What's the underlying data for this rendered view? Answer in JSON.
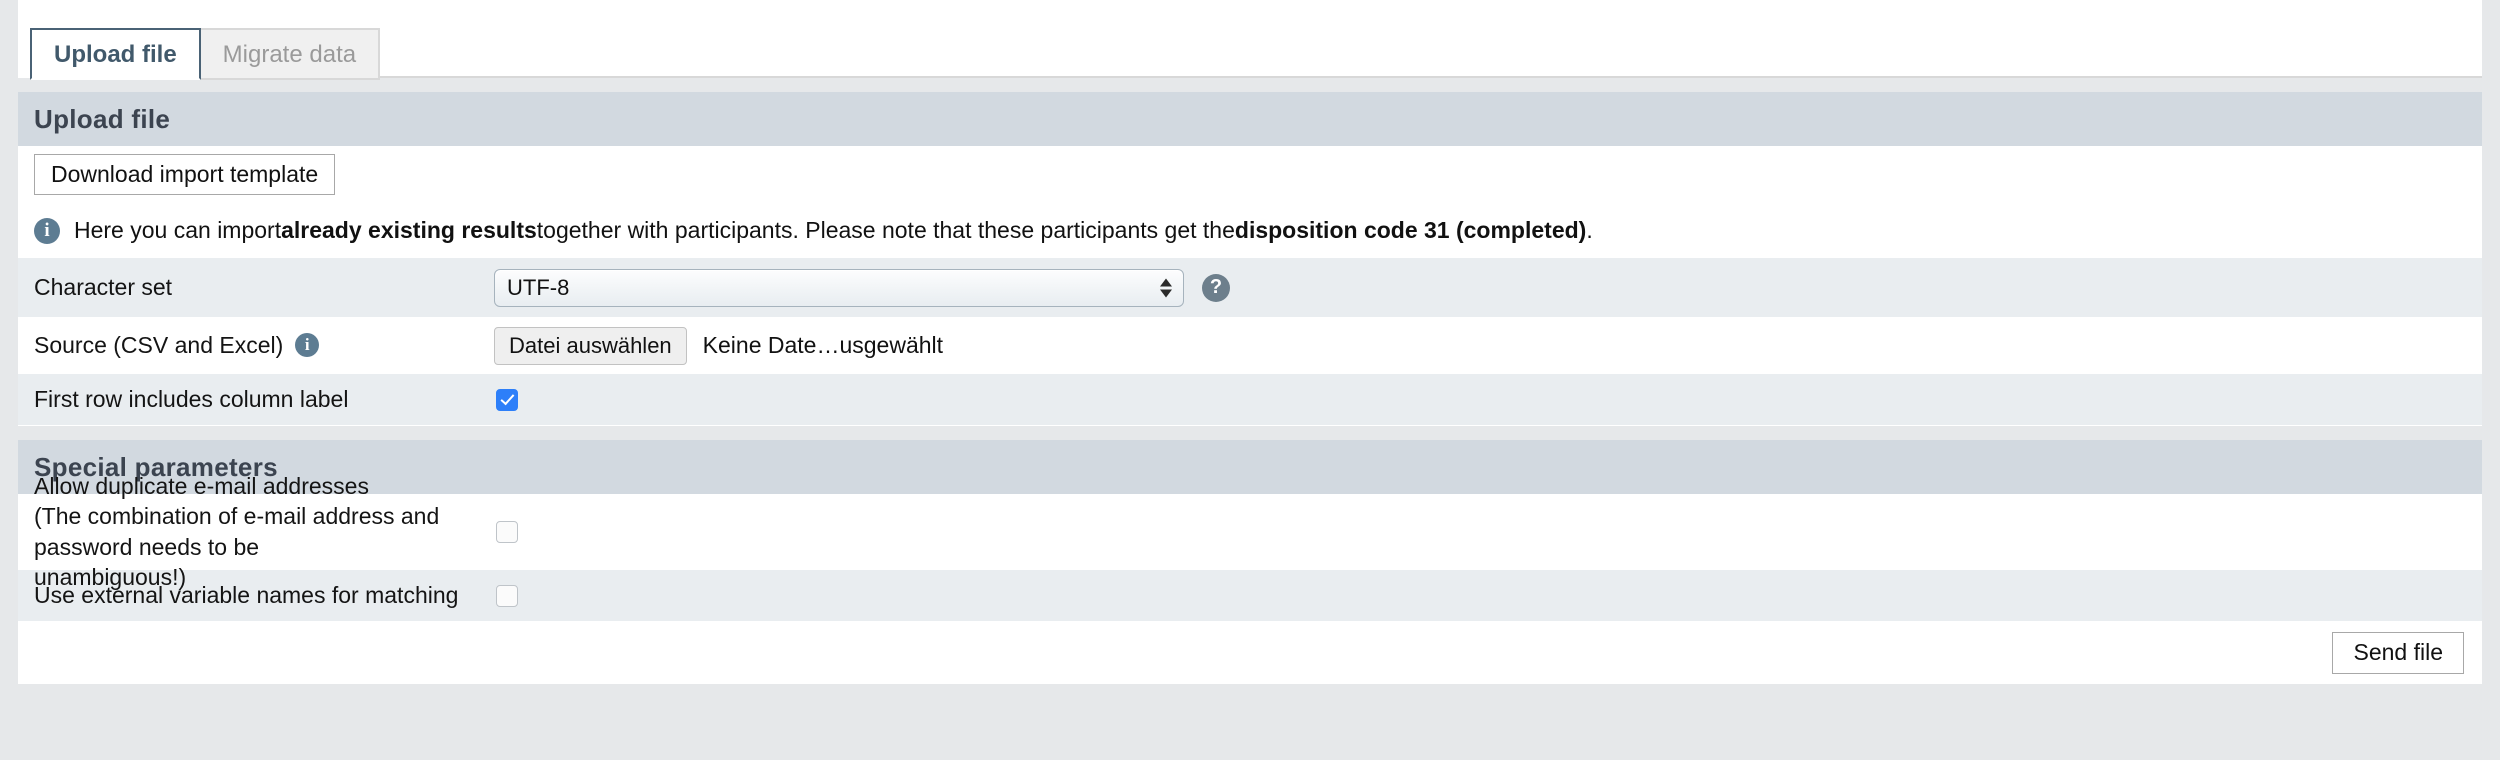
{
  "tabs": [
    {
      "label": "Upload file",
      "active": true
    },
    {
      "label": "Migrate data",
      "active": false
    }
  ],
  "upload_section": {
    "header": "Upload file",
    "download_template_button": "Download import template",
    "info": {
      "icon": "info-icon",
      "part1": "Here you can import ",
      "bold1": "already existing results",
      "part2": " together with participants. Please note that these participants get the ",
      "bold2": "disposition code 31 (completed)",
      "part3": "."
    },
    "rows": {
      "character_set": {
        "label": "Character set",
        "value": "UTF-8",
        "options": [
          "UTF-8"
        ],
        "help_icon": "help-circle-icon"
      },
      "source": {
        "label": "Source (CSV and Excel)",
        "info_icon": "info-icon",
        "file_button": "Datei auswählen",
        "file_status": "Keine Date…usgewählt"
      },
      "first_row": {
        "label": "First row includes column label",
        "checked": true
      }
    }
  },
  "special_section": {
    "header": "Special parameters",
    "rows": {
      "duplicate_email": {
        "line1": "Allow duplicate e-mail addresses",
        "line2": "(The combination of e-mail address and password needs to be",
        "line3": "unambiguous!)",
        "checked": false
      },
      "external_variable": {
        "label": "Use external variable names for matching",
        "checked": false
      }
    }
  },
  "footer": {
    "send_button": "Send file"
  },
  "colors": {
    "page_background": "#e6e8ea",
    "section_header": "#d2d9e0",
    "row_shade": "#e9edf0",
    "active_tab_border": "#4a6275",
    "checkbox_checked": "#2d7ff9",
    "info_icon": "#5d7c92"
  }
}
